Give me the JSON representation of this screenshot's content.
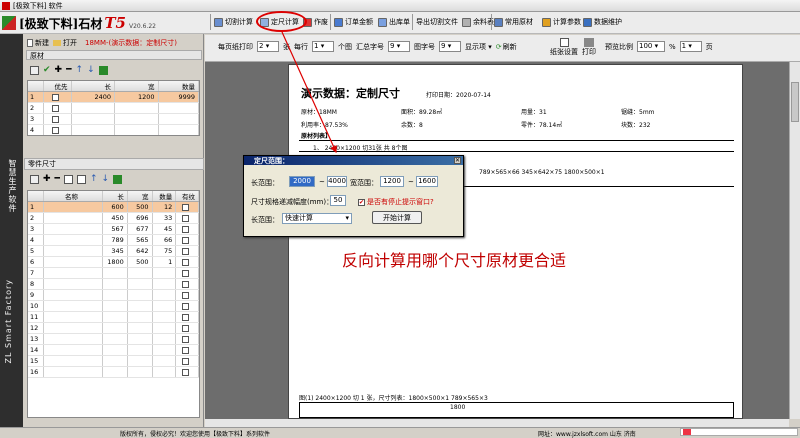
{
  "window": {
    "title": "[极致下料] 软件"
  },
  "logo": {
    "name": "[极致下料]石材",
    "product": "T5",
    "version": "V20.6.22"
  },
  "toolbar": [
    {
      "label": "切割计算",
      "icon": "cut-icon"
    },
    {
      "label": "定尺计算",
      "icon": "calc-icon"
    },
    {
      "label": "作废",
      "icon": "void-icon"
    },
    {
      "label": "订单金额",
      "icon": "money-icon"
    },
    {
      "label": "出库单",
      "icon": "outbound-icon"
    },
    {
      "label": "导出切割文件",
      "icon": "export-icon"
    },
    {
      "label": "余料表",
      "icon": "remnant-icon"
    },
    {
      "label": "常用原材",
      "icon": "material-icon"
    },
    {
      "label": "计算参数",
      "icon": "params-icon"
    },
    {
      "label": "数据维护",
      "icon": "database-icon"
    }
  ],
  "left": {
    "new_label": "新建",
    "open_label": "打开",
    "doc_title": "18MM-(演示数据：定制尺寸)",
    "raw_section": "原材",
    "raw_headers": [
      "",
      "优先",
      "长",
      "宽",
      "数量"
    ],
    "raw_rows": [
      {
        "no": "1",
        "len": "2400",
        "wid": "1200",
        "qty": "9999"
      },
      {
        "no": "2",
        "len": "",
        "wid": "",
        "qty": ""
      },
      {
        "no": "3",
        "len": "",
        "wid": "",
        "qty": ""
      },
      {
        "no": "4",
        "len": "",
        "wid": "",
        "qty": ""
      }
    ],
    "parts_section": "零件尺寸",
    "parts_headers": [
      "",
      "名称",
      "长",
      "宽",
      "数量",
      "有纹"
    ],
    "parts_rows": [
      {
        "no": "1",
        "len": "600",
        "wid": "500",
        "qty": "12"
      },
      {
        "no": "2",
        "len": "450",
        "wid": "696",
        "qty": "33"
      },
      {
        "no": "3",
        "len": "567",
        "wid": "677",
        "qty": "45"
      },
      {
        "no": "4",
        "len": "789",
        "wid": "565",
        "qty": "66"
      },
      {
        "no": "5",
        "len": "345",
        "wid": "642",
        "qty": "75"
      },
      {
        "no": "6",
        "len": "1800",
        "wid": "500",
        "qty": "1"
      },
      {
        "no": "7",
        "len": "",
        "wid": "",
        "qty": ""
      },
      {
        "no": "8",
        "len": "",
        "wid": "",
        "qty": ""
      },
      {
        "no": "9",
        "len": "",
        "wid": "",
        "qty": ""
      },
      {
        "no": "10",
        "len": "",
        "wid": "",
        "qty": ""
      },
      {
        "no": "11",
        "len": "",
        "wid": "",
        "qty": ""
      },
      {
        "no": "12",
        "len": "",
        "wid": "",
        "qty": ""
      },
      {
        "no": "13",
        "len": "",
        "wid": "",
        "qty": ""
      },
      {
        "no": "14",
        "len": "",
        "wid": "",
        "qty": ""
      },
      {
        "no": "15",
        "len": "",
        "wid": "",
        "qty": ""
      },
      {
        "no": "16",
        "len": "",
        "wid": "",
        "qty": ""
      }
    ]
  },
  "sidebar": {
    "text1": "智慧生产软件",
    "text2": "ZL Smart Factory"
  },
  "options": {
    "per_page_label": "每页纸打印",
    "per_page": "2",
    "per_page_unit": "张",
    "per_row_label": "每行",
    "per_row": "1",
    "per_row_unit": "个图",
    "summary_font_label": "汇总字号",
    "summary_font": "9",
    "graph_font_label": "图字号",
    "graph_font": "9",
    "display_label": "显示项",
    "refresh_label": "刷新",
    "paper_label": "纸张设置",
    "print_label": "打印",
    "zoom_label": "预览比例",
    "zoom": "100",
    "zoom_pct": "%",
    "page": "1",
    "page_unit": "页"
  },
  "preview": {
    "title": "演示数据：定制尺寸",
    "print_date": "打印日期：2020-07-14",
    "material": "原材：18MM",
    "area": "面积：89.28㎡",
    "usage": "用量：31",
    "kerf": "锯缝：5mm",
    "utilization": "利用率：87.53%",
    "remnant_count": "余数：8",
    "parts_area": "零件：78.14㎡",
    "cuts": "块数：232",
    "list_header": "原材列表】",
    "list_line": "1、 2400×1200    切31张      共 8个图",
    "size_line": "789×565×66      345×642×75      1800×500×1",
    "footer": "图(1) 2400×1200 切 1 张，尺寸列表：1800×500×1 789×565×3",
    "ruler": "1800"
  },
  "dialog": {
    "title": "定尺范围：",
    "len_label": "长范围：",
    "len_from": "2000",
    "len_to": "4000",
    "wid_label": "宽范围：",
    "wid_from": "1200",
    "wid_to": "1600",
    "step_label": "尺寸规格递减幅度(mm)：",
    "step": "50",
    "stop_label": "是否有停止提示窗口?",
    "range_label": "长范围：",
    "range_value": "快速计算",
    "start_label": "开始计算",
    "tilde": "~"
  },
  "annotation": "反向计算用哪个尺寸原材更合适",
  "status": {
    "left": "版权所有，侵权必究！欢迎您使用【极致下料】系列软件",
    "right": "网址：www.jzxlsoft.com 山东 济南"
  },
  "colors": {
    "accent": "#c00000",
    "selected_row": "#f6c9a0"
  }
}
